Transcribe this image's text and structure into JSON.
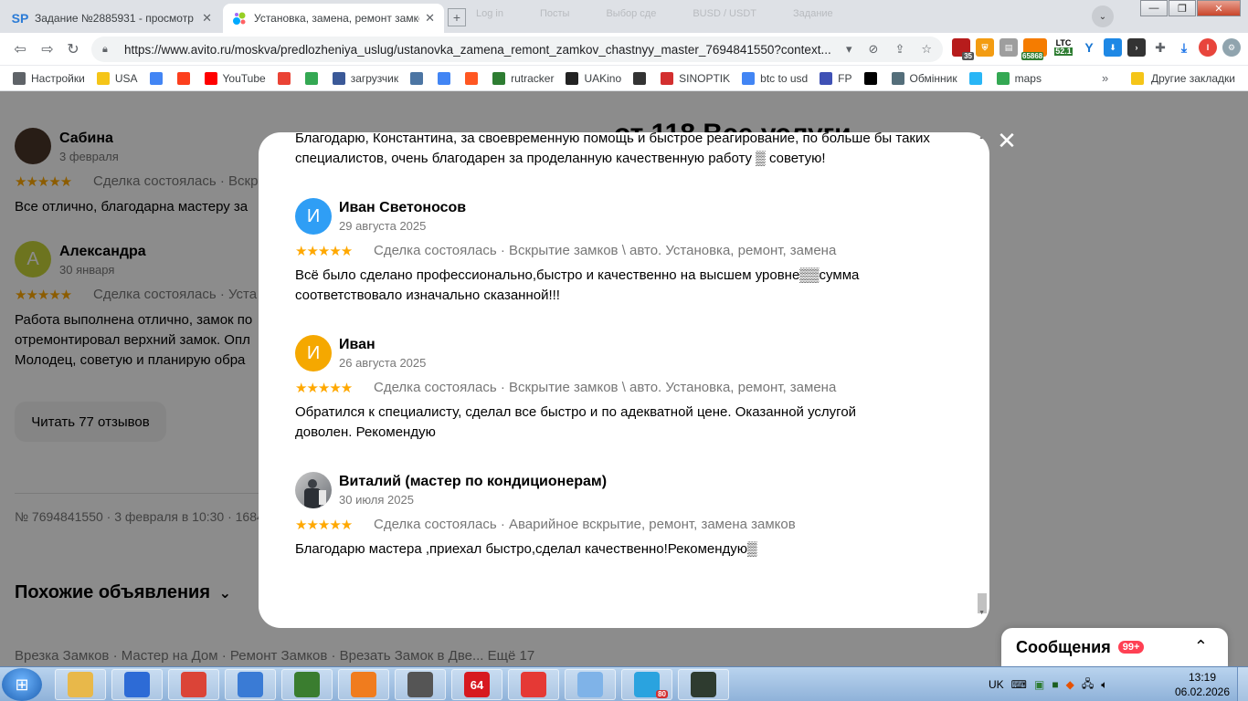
{
  "browser": {
    "tabs": [
      {
        "title": "Задание №2885931 - просмотр з",
        "favicon": "SP",
        "active": false
      },
      {
        "title": "Установка, замена, ремонт замко",
        "favicon": "avito-dots",
        "active": true
      }
    ],
    "ghost_tabs": [
      "Log in",
      "Посты",
      "Выбор сде",
      "BUSD / USDT",
      "Задание"
    ],
    "url": "https://www.avito.ru/moskva/predlozheniya_uslug/ustanovka_zamena_remont_zamkov_chastnyy_master_7694841550?context...",
    "window_buttons": {
      "minimize": "—",
      "maximize": "❐",
      "close": "✕"
    },
    "extensions": {
      "badge_35": "35",
      "badge_65868": "65868",
      "ltc_label": "LTC",
      "ltc_value": "52.1"
    },
    "bookmarks": [
      {
        "label": "Настройки",
        "icon": "gear-icon",
        "color": "#5f6368"
      },
      {
        "label": "USA",
        "icon": "folder-icon",
        "color": "#f5c518"
      },
      {
        "label": "",
        "icon": "google-icon",
        "color": "#4285f4"
      },
      {
        "label": "",
        "icon": "yandex-icon",
        "color": "#fc3f1d"
      },
      {
        "label": "YouTube",
        "icon": "youtube-icon",
        "color": "#ff0000"
      },
      {
        "label": "",
        "icon": "gmail-icon",
        "color": "#ea4335"
      },
      {
        "label": "",
        "icon": "drive-icon",
        "color": "#34a853"
      },
      {
        "label": "загрузчик",
        "icon": "loader-icon",
        "color": "#3b5998"
      },
      {
        "label": "",
        "icon": "vk-icon",
        "color": "#4c75a3"
      },
      {
        "label": "",
        "icon": "translate-icon",
        "color": "#4285f4"
      },
      {
        "label": "",
        "icon": "f-icon",
        "color": "#ff5722"
      },
      {
        "label": "rutracker",
        "icon": "rutracker-icon",
        "color": "#2e7d32"
      },
      {
        "label": "UAKino",
        "icon": "uakino-icon",
        "color": "#222222"
      },
      {
        "label": "",
        "icon": "horse-icon",
        "color": "#333333"
      },
      {
        "label": "SINOPTIK",
        "icon": "thermometer-icon",
        "color": "#d32f2f"
      },
      {
        "label": "btc to usd",
        "icon": "google-icon",
        "color": "#4285f4"
      },
      {
        "label": "FP",
        "icon": "fp-icon",
        "color": "#3f51b5"
      },
      {
        "label": "",
        "icon": "bc-icon",
        "color": "#000000"
      },
      {
        "label": "Обмінник",
        "icon": "diamond-icon",
        "color": "#546e7a"
      },
      {
        "label": "",
        "icon": "star-icon",
        "color": "#29b6f6"
      },
      {
        "label": "maps",
        "icon": "maps-icon",
        "color": "#34a853"
      }
    ],
    "bookmarks_more": "»",
    "other_bookmarks": "Другие закладки"
  },
  "page": {
    "heading_partial": "от 118 Все услуги",
    "bg_reviews": [
      {
        "name": "Сабина",
        "date": "3 февраля",
        "meta": "Сделка состоялась · Вскр",
        "text": "Все отлично, благодарна мастеру за",
        "avatar_letter": "",
        "avatar_color": "#4a3528"
      },
      {
        "name": "Александра",
        "date": "30 января",
        "meta": "Сделка состоялась · Уста",
        "text": "Работа выполнена отлично, замок по\nотремонтировал верхний замок. Опл\nМолодец, советую и планирую обра",
        "avatar_letter": "А",
        "avatar_color": "#c6d33a"
      }
    ],
    "stars": "★★★★★",
    "read_all_button": "Читать 77 отзывов",
    "ad_info": "№ 7694841550 · 3 февраля в 10:30 · 1684",
    "similar_heading": "Похожие объявления",
    "similar_chevron": "⌄",
    "similar_tags": "Врезка Замков · Мастер на Дом · Ремонт Замков · Врезать Замок в Две...  Ещё 17"
  },
  "messages": {
    "label": "Сообщения",
    "badge": "99+",
    "chevron": "⌃"
  },
  "modal": {
    "close_icon": "✕",
    "partial_text": "Благодарю, Константина, за своевременную помощь и быстрое реагирование, по больше бы таких специалистов, очень благодарен за проделанную качественную работу ▒ советую!",
    "reviews": [
      {
        "name": "Иван Светоносов",
        "date": "29 августа 2025",
        "stars": "★★★★★",
        "meta": "Сделка состоялась · Вскрытие замков \\ авто. Установка, ремонт, замена",
        "text": "Всё было сделано профессионально,быстро и качественно на высшем уровне▒▒сумма соответствовало изначально сказанной!!!",
        "avatar_letter": "И",
        "avatar_color": "#2f9ef5"
      },
      {
        "name": "Иван",
        "date": "26 августа 2025",
        "stars": "★★★★★",
        "meta": "Сделка состоялась · Вскрытие замков \\ авто. Установка, ремонт, замена",
        "text": "Обратился к специалисту, сделал все быстро и по адекватной цене. Оказанной услугой доволен. Рекомендую",
        "avatar_letter": "И",
        "avatar_color": "#f5a800"
      },
      {
        "name": "Виталий (мастер по кондиционерам)",
        "date": "30 июля 2025",
        "stars": "★★★★★",
        "meta": "Сделка состоялась · Аварийное вскрытие, ремонт, замена замков",
        "text": "Благодарю мастера ,приехал быстро,сделал качественно!Рекомендую▒",
        "avatar_letter": "",
        "avatar_color": "#8a8f95"
      }
    ]
  },
  "taskbar": {
    "lang": "UK",
    "time": "13:19",
    "date": "06.02.2026",
    "apps": [
      {
        "icon": "explorer-icon",
        "color": "#e8b84a",
        "label": ""
      },
      {
        "icon": "shield-icon",
        "color": "#2d6bd6",
        "label": ""
      },
      {
        "icon": "chrome-icon",
        "color": "#db4437",
        "label": ""
      },
      {
        "icon": "globe-icon",
        "color": "#3a7bd5",
        "label": ""
      },
      {
        "icon": "spreadsheet-icon",
        "color": "#3a7d2f",
        "label": ""
      },
      {
        "icon": "media-icon",
        "color": "#f07c1e",
        "label": ""
      },
      {
        "icon": "clock-app-icon",
        "color": "#555555",
        "label": ""
      },
      {
        "icon": "app-64-icon",
        "color": "#d71920",
        "label": "64"
      },
      {
        "icon": "chart-app-icon",
        "color": "#e53935",
        "label": ""
      },
      {
        "icon": "notepad-icon",
        "color": "#7fb3e8",
        "label": ""
      },
      {
        "icon": "telegram-icon",
        "color": "#2aa3df",
        "label": ""
      },
      {
        "icon": "terminal-icon",
        "color": "#2e3b2f",
        "label": ""
      }
    ],
    "telegram_badge": "80"
  }
}
